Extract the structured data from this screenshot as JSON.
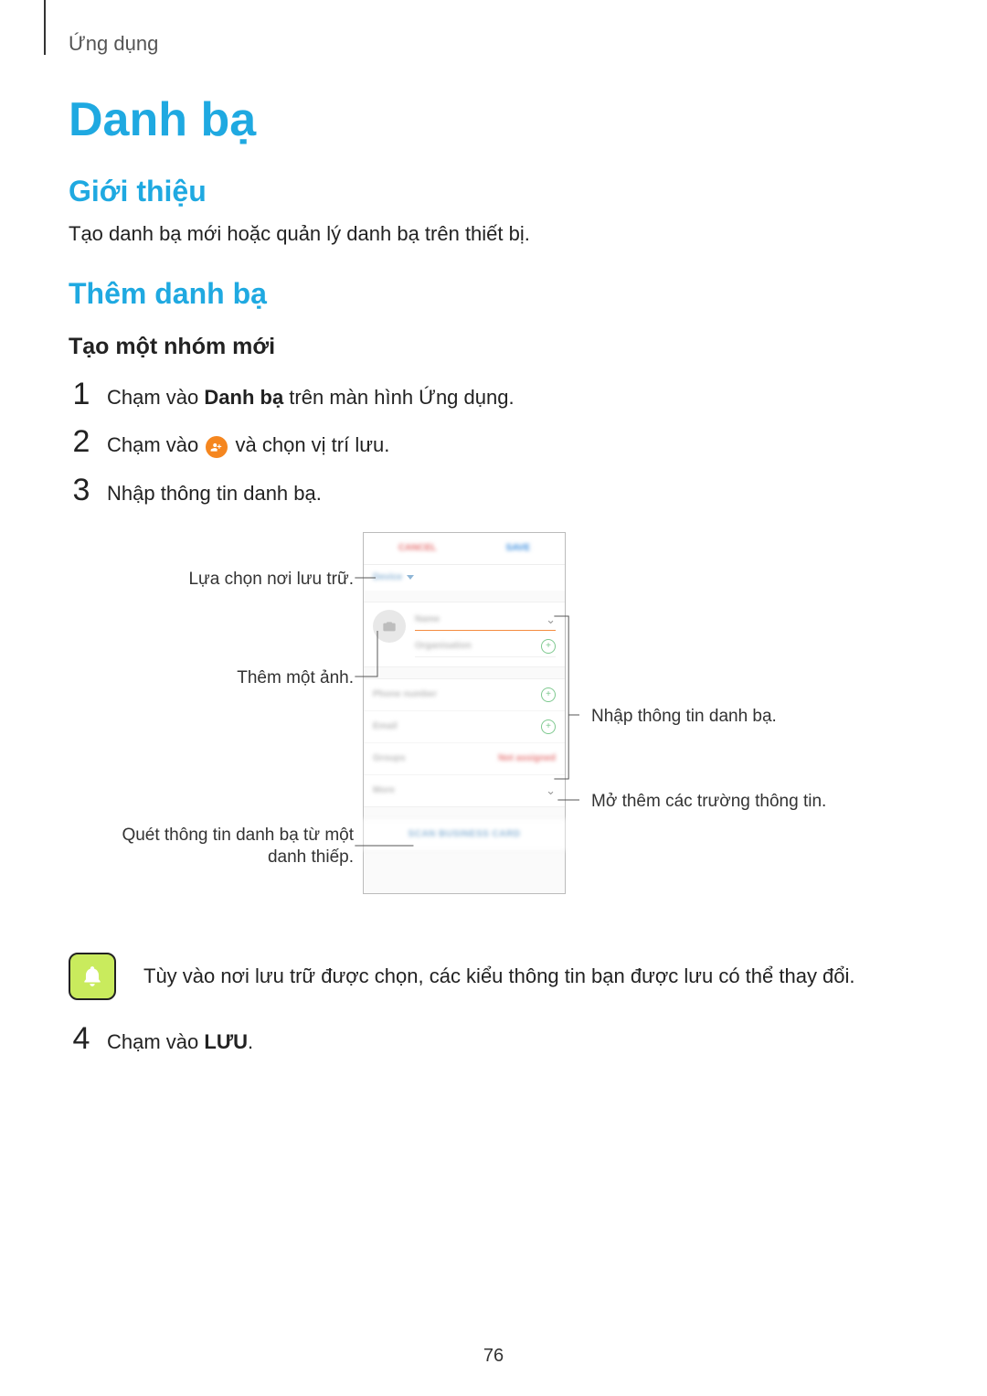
{
  "breadcrumb": "Ứng dụng",
  "h1": "Danh bạ",
  "section_intro": {
    "title": "Giới thiệu",
    "para": "Tạo danh bạ mới hoặc quản lý danh bạ trên thiết bị."
  },
  "section_add": {
    "title": "Thêm danh bạ",
    "subtitle": "Tạo một nhóm mới"
  },
  "steps": {
    "s1": {
      "num": "1",
      "pre": "Chạm vào ",
      "bold": "Danh bạ",
      "post": " trên màn hình Ứng dụng."
    },
    "s2": {
      "num": "2",
      "pre": "Chạm vào ",
      "post": " và chọn vị trí lưu."
    },
    "s3": {
      "num": "3",
      "text": "Nhập thông tin danh bạ."
    },
    "s4": {
      "num": "4",
      "pre": "Chạm vào ",
      "bold": "LƯU",
      "post": "."
    }
  },
  "diagram": {
    "callouts": {
      "storage": "Lựa chọn nơi lưu trữ.",
      "add_image": "Thêm một ảnh.",
      "scan_line1": "Quét thông tin danh bạ từ một",
      "scan_line2": "danh thiếp.",
      "enter_info": "Nhập thông tin danh bạ.",
      "open_more": "Mở thêm các trường thông tin."
    },
    "phone": {
      "cancel": "CANCEL",
      "save": "SAVE",
      "storage": "Device",
      "name": "Name",
      "org": "Organisation",
      "phone": "Phone number",
      "email": "Email",
      "groups": "Groups",
      "groups_val": "Not assigned",
      "more": "More",
      "scan": "SCAN BUSINESS CARD"
    }
  },
  "note": "Tùy vào nơi lưu trữ được chọn, các kiểu thông tin bạn được lưu có thể thay đổi.",
  "page_number": "76"
}
